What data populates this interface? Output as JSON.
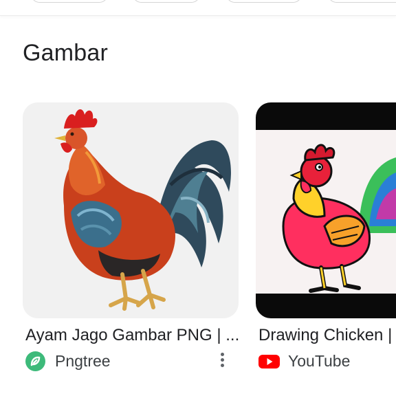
{
  "section": {
    "title": "Gambar"
  },
  "results": [
    {
      "title": "Ayam Jago Gambar PNG | ...",
      "source": "Pngtree",
      "source_icon": "pngtree-icon",
      "image": "rooster-illustration"
    },
    {
      "title": "Drawing Chicken |",
      "source": "YouTube",
      "source_icon": "youtube-icon",
      "image": "cartoon-rooster-drawing"
    }
  ],
  "colors": {
    "title_text": "#202124",
    "source_text": "#3c4043",
    "pngtree_green": "#3dba7a",
    "youtube_red": "#ff0000"
  }
}
